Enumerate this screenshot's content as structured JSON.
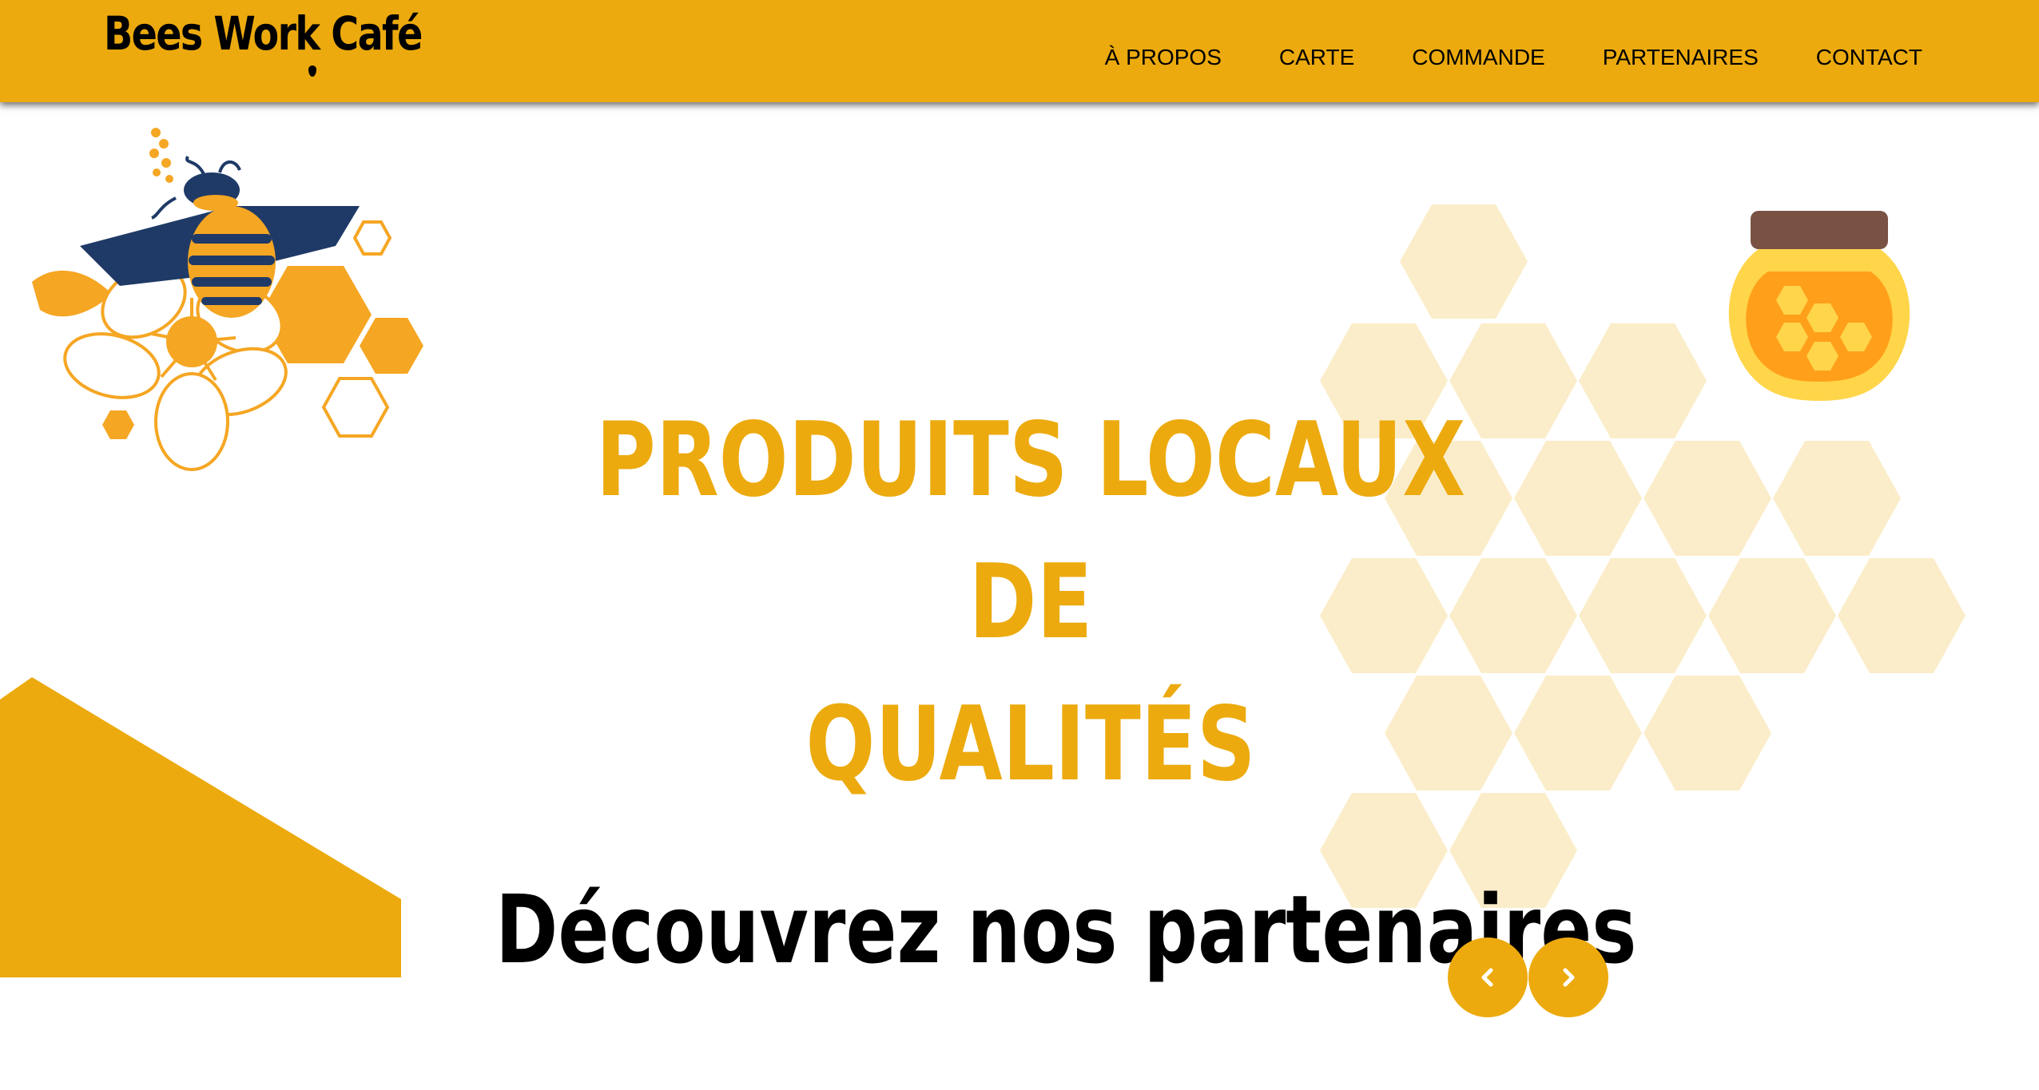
{
  "brand": {
    "name": "Bees Work Café"
  },
  "nav": {
    "items": [
      {
        "label": "À PROPOS"
      },
      {
        "label": "CARTE"
      },
      {
        "label": "COMMANDE"
      },
      {
        "label": "PARTENAIRES"
      },
      {
        "label": "CONTACT"
      }
    ]
  },
  "hero": {
    "title_line1": "PRODUITS LOCAUX DE",
    "title_line2": "QUALITÉS"
  },
  "partners": {
    "title": "Découvrez nos partenaires",
    "prev_icon": "chevron-left-icon",
    "next_icon": "chevron-right-icon"
  },
  "colors": {
    "accent": "#ecaa0e",
    "honeycomb_light": "#fbedc9",
    "bee_navy": "#1f3a66",
    "flower_orange": "#f5a623",
    "jar_lid": "#7a5244"
  }
}
